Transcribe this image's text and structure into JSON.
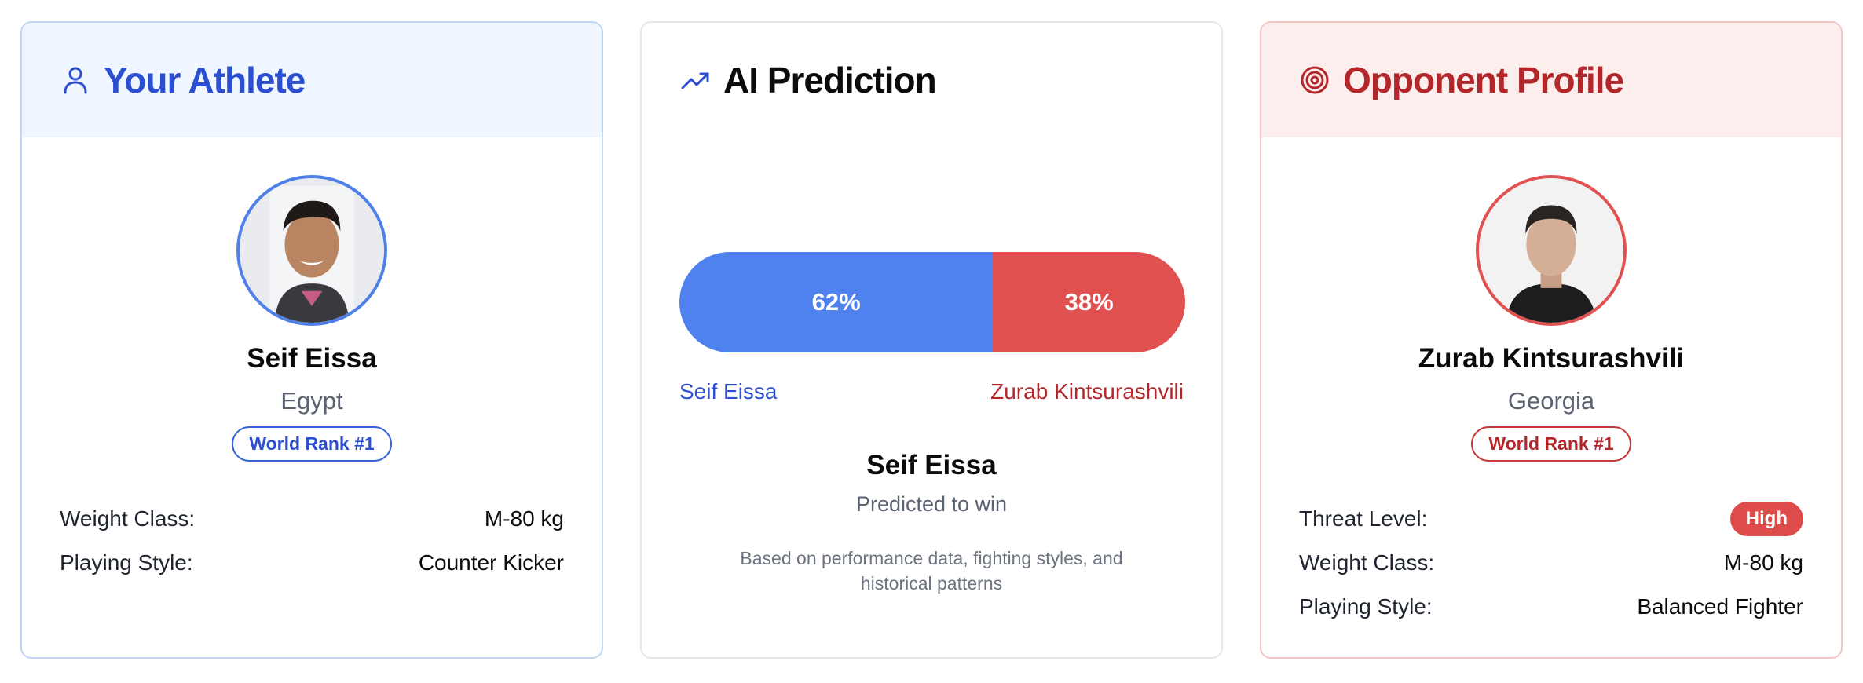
{
  "athlete_card": {
    "title": "Your Athlete",
    "icon": "user-icon",
    "name": "Seif Eissa",
    "country": "Egypt",
    "rank": "World Rank #1",
    "stats": [
      {
        "label": "Weight Class:",
        "value": "M-80 kg"
      },
      {
        "label": "Playing Style:",
        "value": "Counter Kicker"
      }
    ],
    "accent": "#2b4fd0"
  },
  "prediction_card": {
    "title": "AI Prediction",
    "icon": "trending-up-icon",
    "win_probability": {
      "athlete": 62,
      "opponent": 38
    },
    "athlete_pct_label": "62%",
    "opponent_pct_label": "38%",
    "athlete_name": "Seif Eissa",
    "opponent_name": "Zurab Kintsurashvili",
    "winner": "Seif Eissa",
    "winner_sub": "Predicted to win",
    "basis": "Based on performance data, fighting styles, and historical patterns",
    "colors": {
      "athlete": "#4f82ee",
      "opponent": "#e0514f"
    }
  },
  "opponent_card": {
    "title": "Opponent Profile",
    "icon": "target-icon",
    "name": "Zurab Kintsurashvili",
    "country": "Georgia",
    "rank": "World Rank #1",
    "threat_label": "Threat Level:",
    "threat_value": "High",
    "stats": [
      {
        "label": "Weight Class:",
        "value": "M-80 kg"
      },
      {
        "label": "Playing Style:",
        "value": "Balanced Fighter"
      }
    ],
    "accent": "#b3262a"
  }
}
